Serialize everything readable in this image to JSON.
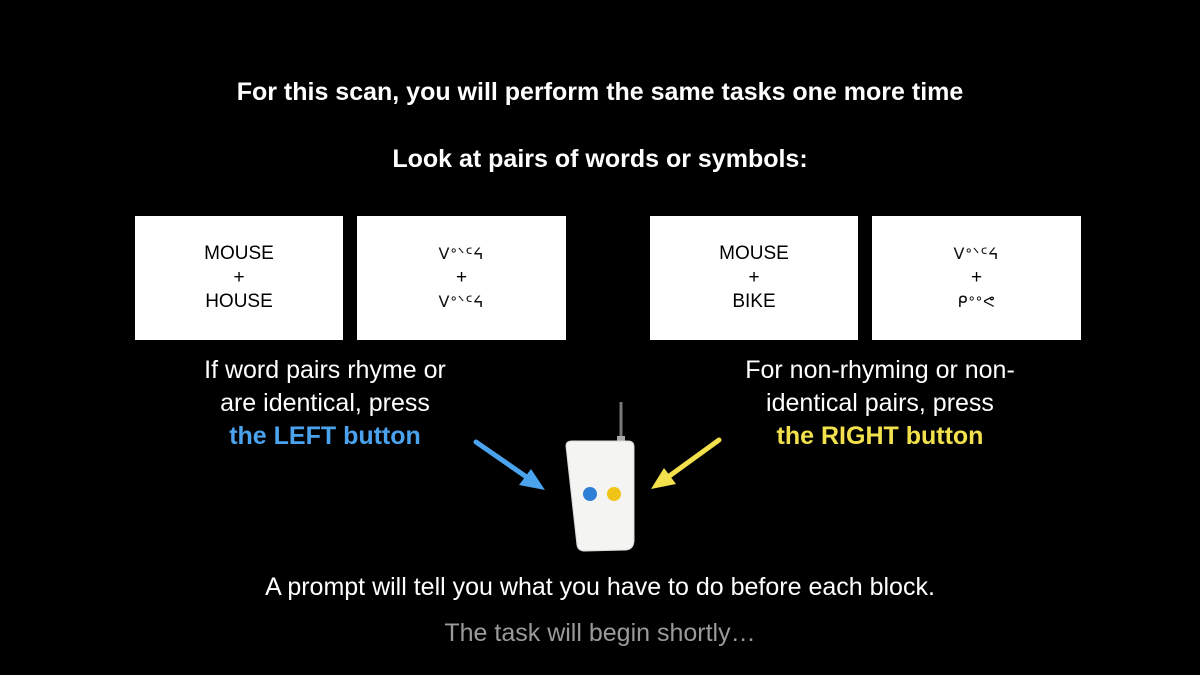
{
  "heading": {
    "line1": "For this scan, you will perform the same tasks one more time",
    "line2": "Look at pairs of words or symbols:"
  },
  "cards": [
    {
      "top": "MOUSE",
      "plus": "+",
      "bottom": "HOUSE"
    },
    {
      "top": "ᐯᐤᐠᑦᔦ",
      "plus": "+",
      "bottom": "ᐯᐤᐠᑦᔦ"
    },
    {
      "top": "MOUSE",
      "plus": "+",
      "bottom": "BIKE"
    },
    {
      "top": "ᐯᐤᐠᑦᔦ",
      "plus": "+",
      "bottom": "ᑭᐤᐤᕙ"
    }
  ],
  "instructions": {
    "left": {
      "line1": "If word pairs rhyme or",
      "line2": "are identical, press",
      "highlight": "the LEFT button"
    },
    "right": {
      "line1": "For non-rhyming or non-",
      "line2": "identical pairs, press",
      "highlight": "the RIGHT button"
    }
  },
  "colors": {
    "left_button": "#2e7fd6",
    "right_button": "#f0c419",
    "left_arrow": "#4aa3ec",
    "right_arrow": "#f2e14c",
    "background": "#000000"
  },
  "footer": {
    "prompt": "A prompt will tell you what you have to do before each block.",
    "begin": "The task will begin shortly…"
  }
}
